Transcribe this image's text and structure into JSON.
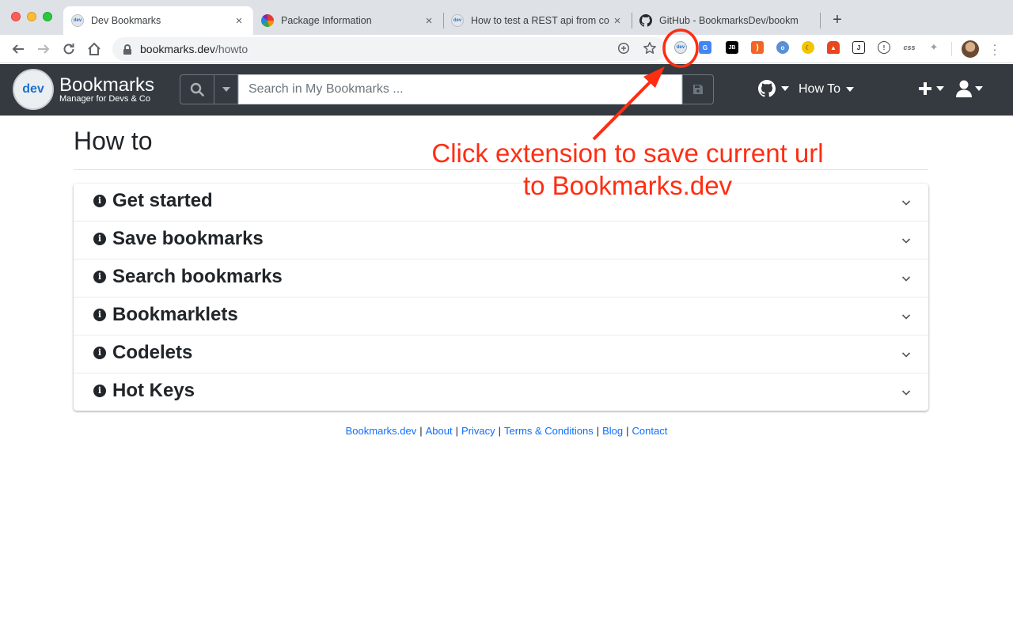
{
  "browser": {
    "tabs": [
      {
        "title": "Dev Bookmarks",
        "favicon": "dev-bookmarks-favicon",
        "active": true
      },
      {
        "title": "Package Information",
        "favicon": "rainbow-favicon",
        "active": false
      },
      {
        "title": "How to test a REST api from co",
        "favicon": "dev-bookmarks-favicon",
        "active": false
      },
      {
        "title": "GitHub - BookmarksDev/bookm",
        "favicon": "github-icon",
        "active": false
      }
    ],
    "new_tab": "+",
    "close_glyph": "×",
    "address_bar": {
      "host": "bookmarks.dev",
      "path": "/howto"
    },
    "extensions": [
      "bookmarks-dev-extension",
      "google-translate",
      "jetbrains",
      "rss",
      "opera",
      "night-mode",
      "fire-extension",
      "j-extension",
      "lightbulb",
      "css",
      "pin"
    ]
  },
  "site": {
    "brand_logo_text": "dev",
    "brand_title": "Bookmarks",
    "brand_subtitle": "Manager for Devs & Co",
    "search_placeholder": "Search in My Bookmarks ...",
    "nav": {
      "github_dropdown": "github-icon",
      "how_to": "How To",
      "add_menu": "plus-icon",
      "user_menu": "user-icon"
    }
  },
  "main": {
    "title": "How to",
    "sections": [
      {
        "label": "Get started"
      },
      {
        "label": "Save bookmarks"
      },
      {
        "label": "Search bookmarks"
      },
      {
        "label": "Bookmarklets"
      },
      {
        "label": "Codelets"
      },
      {
        "label": "Hot Keys"
      }
    ]
  },
  "footer": {
    "links": [
      "Bookmarks.dev",
      "About",
      "Privacy",
      "Terms & Conditions",
      "Blog",
      "Contact"
    ]
  },
  "annotation": {
    "line1": "Click extension to save current url",
    "line2": "to Bookmarks.dev",
    "color": "#ff2d12"
  }
}
